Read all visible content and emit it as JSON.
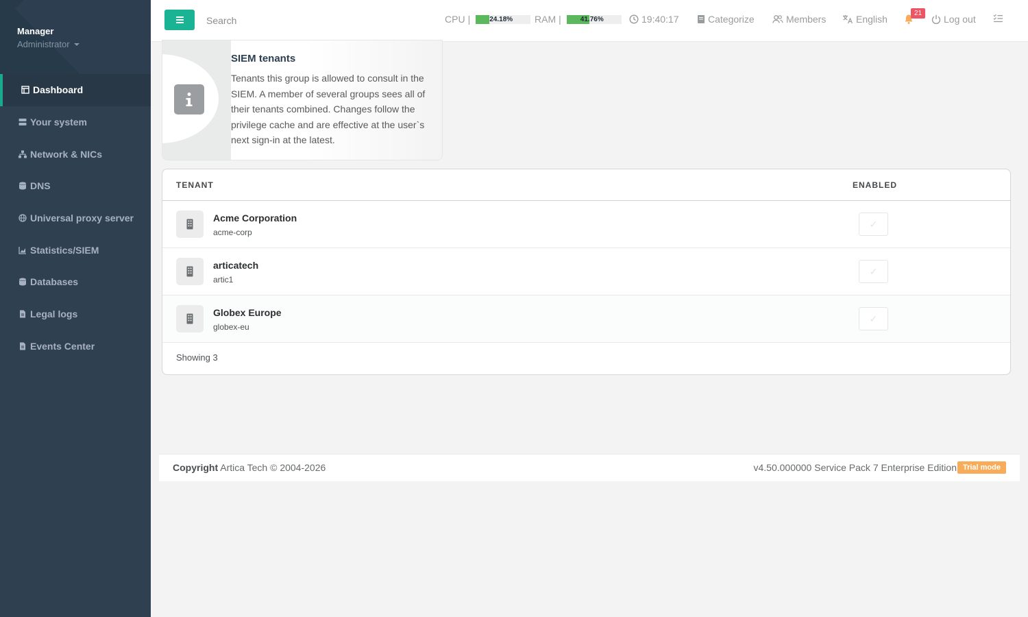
{
  "sidebar": {
    "profile_name": "Manager",
    "profile_role": "Administrator",
    "items": [
      {
        "label": "Dashboard",
        "icon": "dashboard-icon"
      },
      {
        "label": "Your system",
        "icon": "server-icon"
      },
      {
        "label": "Network & NICs",
        "icon": "network-icon"
      },
      {
        "label": "DNS",
        "icon": "database-icon"
      },
      {
        "label": "Universal proxy server",
        "icon": "globe-icon"
      },
      {
        "label": "Statistics/SIEM",
        "icon": "chart-icon"
      },
      {
        "label": "Databases",
        "icon": "database-icon"
      },
      {
        "label": "Legal logs",
        "icon": "file-icon"
      },
      {
        "label": "Events Center",
        "icon": "file-icon"
      }
    ]
  },
  "topbar": {
    "search_placeholder": "Search",
    "cpu_label": "CPU",
    "cpu_value": "24.18%",
    "cpu_fraction": 0.2418,
    "ram_label": "RAM",
    "ram_value": "41.76%",
    "ram_fraction": 0.4176,
    "time": "19:40:17",
    "categorize": "Categorize",
    "members": "Members",
    "language": "English",
    "notifications_count": "21",
    "logout": "Log out"
  },
  "info": {
    "title": "SIEM tenants",
    "text": "Tenants this group is allowed to consult in the SIEM. A member of several groups sees all of their tenants combined. Changes follow the privilege cache and are effective at the user`s next sign-in at the latest."
  },
  "table": {
    "col_tenant": "TENANT",
    "col_enabled": "ENABLED",
    "rows": [
      {
        "name": "Acme Corporation",
        "id": "acme-corp",
        "enabled": false
      },
      {
        "name": "articatech",
        "id": "artic1",
        "enabled": false
      },
      {
        "name": "Globex Europe",
        "id": "globex-eu",
        "enabled": false
      }
    ],
    "footer": "Showing 3"
  },
  "footer": {
    "copyright_label": "Copyright",
    "copyright_text": " Artica Tech © 2004-2026",
    "version": "v4.50.000000 Service Pack 7 Enterprise Edition",
    "trial_badge": "Trial mode"
  },
  "colors": {
    "accent": "#1ab394",
    "sidebar_bg": "#2f4050",
    "meter_fill": "#5cb85c",
    "badge_red": "#ed5565",
    "trial_orange": "#f8ac59"
  }
}
